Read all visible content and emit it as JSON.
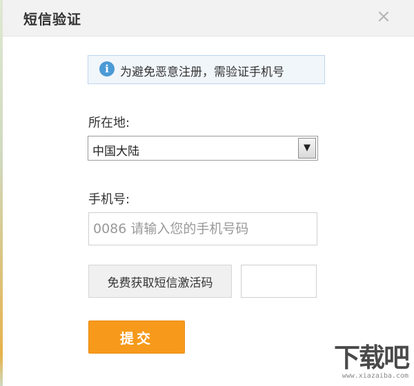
{
  "dialog": {
    "title": "短信验证",
    "close_glyph": "×",
    "close_icon": "close-icon"
  },
  "notice": {
    "icon": "info-icon",
    "icon_glyph": "i",
    "text": "为避免恶意注册，需验证手机号",
    "color": "#4b9ad6"
  },
  "region": {
    "label": "所在地:",
    "selected": "中国大陆",
    "arrow_glyph": "▼"
  },
  "phone": {
    "label": "手机号:",
    "value": "",
    "placeholder": "0086 请输入您的手机号码"
  },
  "sms": {
    "button_label": "免费获取短信激活码",
    "code_value": ""
  },
  "submit": {
    "label": "提交",
    "color": "#f79a1b"
  },
  "watermark": {
    "logo_text": "下载吧",
    "site_text": "www.xiazaiba.com"
  }
}
